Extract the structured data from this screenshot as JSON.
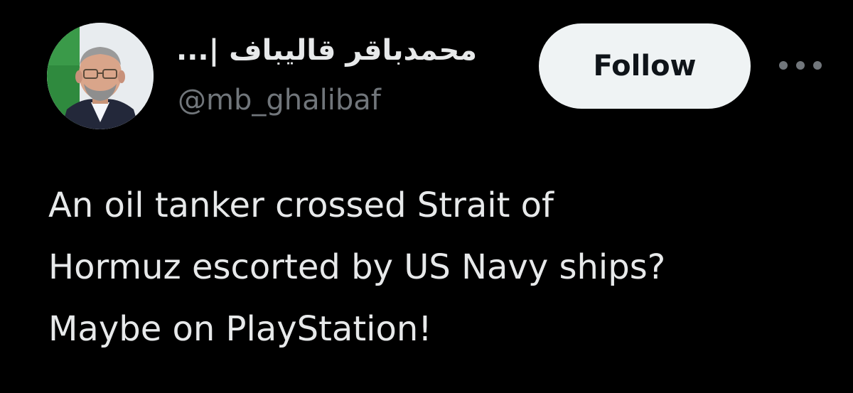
{
  "user": {
    "display_name": "محمدباقر قالیباف |...",
    "handle": "@mb_ghalibaf",
    "avatar_icon": "profile-photo"
  },
  "actions": {
    "follow_label": "Follow",
    "more_icon": "ellipsis-icon"
  },
  "tweet": {
    "lines": [
      "An oil tanker crossed Strait of",
      "Hormuz escorted by US Navy ships?",
      "Maybe on PlayStation!"
    ]
  },
  "colors": {
    "background": "#000000",
    "text": "#e7e9ea",
    "secondary_text": "#71767b",
    "button_bg": "#eff3f4",
    "button_text": "#0f1419"
  }
}
